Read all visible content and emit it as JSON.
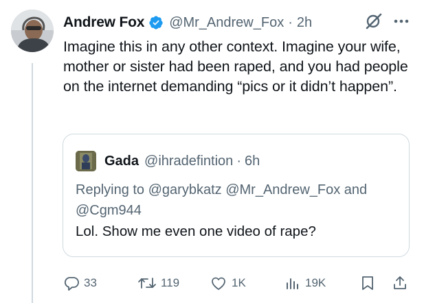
{
  "tweet": {
    "author_name": "Andrew Fox",
    "handle": "@Mr_Andrew_Fox",
    "separator": "·",
    "time": "2h",
    "text": "Imagine this in any other context. Imagine your wife, mother or sister had been raped, and you had people on the internet demanding “pics or it didn’t happen”.",
    "verified_color": "#1d9bf0"
  },
  "quote": {
    "author_name": "Gada",
    "handle": "@ihradefintion",
    "separator": "·",
    "time": "6h",
    "replying_prefix": "Replying to",
    "replying_to_1": "@garybkatz",
    "replying_to_2": "@Mr_Andrew_Fox",
    "replying_and": "and",
    "replying_to_3": "@Cgm944",
    "text": "Lol. Show me even one video of rape?"
  },
  "actions": {
    "replies": "33",
    "retweets": "119",
    "likes": "1K",
    "views": "19K"
  },
  "icons": [
    "grok-icon",
    "more-icon",
    "reply-icon",
    "retweet-icon",
    "like-icon",
    "views-icon",
    "bookmark-icon",
    "share-icon",
    "verified-badge-icon"
  ]
}
